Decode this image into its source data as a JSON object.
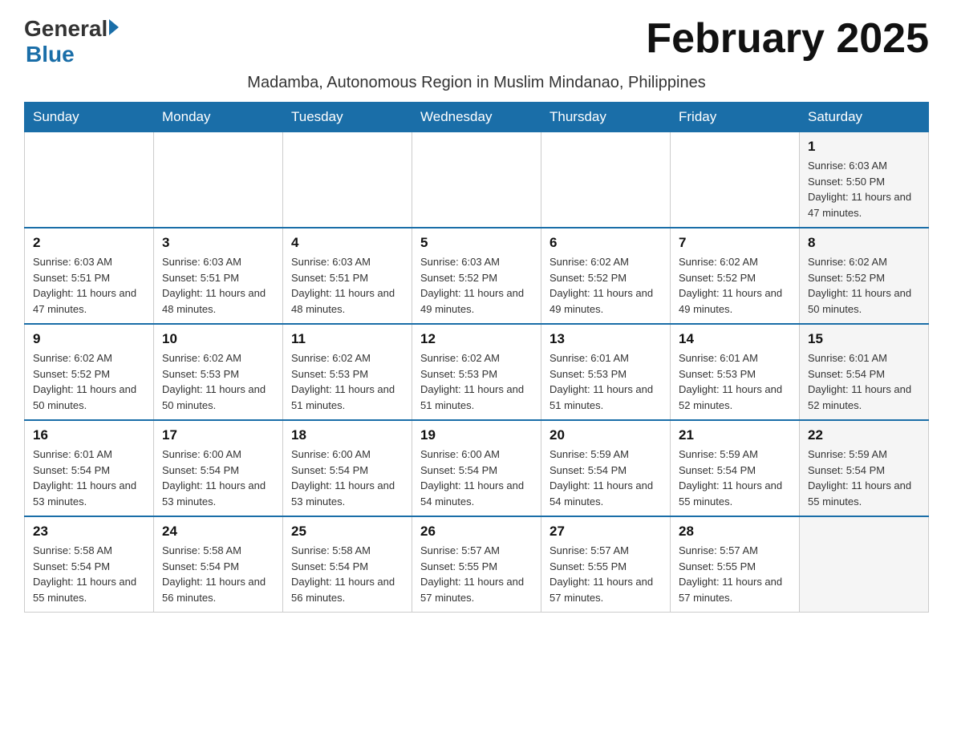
{
  "header": {
    "logo_general": "General",
    "logo_blue": "Blue",
    "month_title": "February 2025",
    "subtitle": "Madamba, Autonomous Region in Muslim Mindanao, Philippines"
  },
  "days_of_week": [
    "Sunday",
    "Monday",
    "Tuesday",
    "Wednesday",
    "Thursday",
    "Friday",
    "Saturday"
  ],
  "weeks": [
    {
      "days": [
        {
          "num": "",
          "info": ""
        },
        {
          "num": "",
          "info": ""
        },
        {
          "num": "",
          "info": ""
        },
        {
          "num": "",
          "info": ""
        },
        {
          "num": "",
          "info": ""
        },
        {
          "num": "",
          "info": ""
        },
        {
          "num": "1",
          "info": "Sunrise: 6:03 AM\nSunset: 5:50 PM\nDaylight: 11 hours and 47 minutes."
        }
      ]
    },
    {
      "days": [
        {
          "num": "2",
          "info": "Sunrise: 6:03 AM\nSunset: 5:51 PM\nDaylight: 11 hours and 47 minutes."
        },
        {
          "num": "3",
          "info": "Sunrise: 6:03 AM\nSunset: 5:51 PM\nDaylight: 11 hours and 48 minutes."
        },
        {
          "num": "4",
          "info": "Sunrise: 6:03 AM\nSunset: 5:51 PM\nDaylight: 11 hours and 48 minutes."
        },
        {
          "num": "5",
          "info": "Sunrise: 6:03 AM\nSunset: 5:52 PM\nDaylight: 11 hours and 49 minutes."
        },
        {
          "num": "6",
          "info": "Sunrise: 6:02 AM\nSunset: 5:52 PM\nDaylight: 11 hours and 49 minutes."
        },
        {
          "num": "7",
          "info": "Sunrise: 6:02 AM\nSunset: 5:52 PM\nDaylight: 11 hours and 49 minutes."
        },
        {
          "num": "8",
          "info": "Sunrise: 6:02 AM\nSunset: 5:52 PM\nDaylight: 11 hours and 50 minutes."
        }
      ]
    },
    {
      "days": [
        {
          "num": "9",
          "info": "Sunrise: 6:02 AM\nSunset: 5:52 PM\nDaylight: 11 hours and 50 minutes."
        },
        {
          "num": "10",
          "info": "Sunrise: 6:02 AM\nSunset: 5:53 PM\nDaylight: 11 hours and 50 minutes."
        },
        {
          "num": "11",
          "info": "Sunrise: 6:02 AM\nSunset: 5:53 PM\nDaylight: 11 hours and 51 minutes."
        },
        {
          "num": "12",
          "info": "Sunrise: 6:02 AM\nSunset: 5:53 PM\nDaylight: 11 hours and 51 minutes."
        },
        {
          "num": "13",
          "info": "Sunrise: 6:01 AM\nSunset: 5:53 PM\nDaylight: 11 hours and 51 minutes."
        },
        {
          "num": "14",
          "info": "Sunrise: 6:01 AM\nSunset: 5:53 PM\nDaylight: 11 hours and 52 minutes."
        },
        {
          "num": "15",
          "info": "Sunrise: 6:01 AM\nSunset: 5:54 PM\nDaylight: 11 hours and 52 minutes."
        }
      ]
    },
    {
      "days": [
        {
          "num": "16",
          "info": "Sunrise: 6:01 AM\nSunset: 5:54 PM\nDaylight: 11 hours and 53 minutes."
        },
        {
          "num": "17",
          "info": "Sunrise: 6:00 AM\nSunset: 5:54 PM\nDaylight: 11 hours and 53 minutes."
        },
        {
          "num": "18",
          "info": "Sunrise: 6:00 AM\nSunset: 5:54 PM\nDaylight: 11 hours and 53 minutes."
        },
        {
          "num": "19",
          "info": "Sunrise: 6:00 AM\nSunset: 5:54 PM\nDaylight: 11 hours and 54 minutes."
        },
        {
          "num": "20",
          "info": "Sunrise: 5:59 AM\nSunset: 5:54 PM\nDaylight: 11 hours and 54 minutes."
        },
        {
          "num": "21",
          "info": "Sunrise: 5:59 AM\nSunset: 5:54 PM\nDaylight: 11 hours and 55 minutes."
        },
        {
          "num": "22",
          "info": "Sunrise: 5:59 AM\nSunset: 5:54 PM\nDaylight: 11 hours and 55 minutes."
        }
      ]
    },
    {
      "days": [
        {
          "num": "23",
          "info": "Sunrise: 5:58 AM\nSunset: 5:54 PM\nDaylight: 11 hours and 55 minutes."
        },
        {
          "num": "24",
          "info": "Sunrise: 5:58 AM\nSunset: 5:54 PM\nDaylight: 11 hours and 56 minutes."
        },
        {
          "num": "25",
          "info": "Sunrise: 5:58 AM\nSunset: 5:54 PM\nDaylight: 11 hours and 56 minutes."
        },
        {
          "num": "26",
          "info": "Sunrise: 5:57 AM\nSunset: 5:55 PM\nDaylight: 11 hours and 57 minutes."
        },
        {
          "num": "27",
          "info": "Sunrise: 5:57 AM\nSunset: 5:55 PM\nDaylight: 11 hours and 57 minutes."
        },
        {
          "num": "28",
          "info": "Sunrise: 5:57 AM\nSunset: 5:55 PM\nDaylight: 11 hours and 57 minutes."
        },
        {
          "num": "",
          "info": ""
        }
      ]
    }
  ]
}
